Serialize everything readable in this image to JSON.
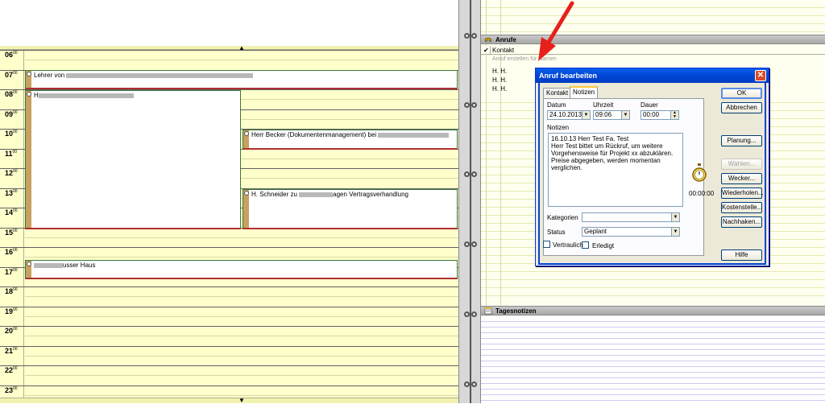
{
  "calendar": {
    "hours": [
      "06",
      "07",
      "08",
      "09",
      "10",
      "11",
      "12",
      "13",
      "14",
      "15",
      "16",
      "17",
      "18",
      "19",
      "20",
      "21",
      "22",
      "23"
    ],
    "minutes_suffix": "00",
    "appointments": [
      {
        "text": "Lehrer von",
        "redacted": true
      },
      {
        "text": "H",
        "redacted": true
      },
      {
        "text": "Herr Becker (Dokumentenmanagement) bei",
        "redacted": true
      },
      {
        "text": "H. Schneider zu",
        "text_after": "agen Vertragsverhandlung",
        "redacted": true
      },
      {
        "text": "",
        "text_after": "usser Haus",
        "redacted": true
      }
    ]
  },
  "right_panel": {
    "calls_section": {
      "title": "Anrufe",
      "check_mark": "✔",
      "column_header": "Kontakt",
      "new_call_placeholder": "Anruf erstellen für Namen",
      "rows": [
        "H. H.",
        "H. H.",
        "H. H."
      ]
    },
    "notes_section": {
      "title": "Tagesnotizen"
    }
  },
  "dialog": {
    "title": "Anruf bearbeiten",
    "close_glyph": "✕",
    "tabs": [
      "Kontakt",
      "Notizen"
    ],
    "active_tab": "Notizen",
    "date_label": "Datum",
    "date_value": "24.10.2013",
    "time_label": "Uhrzeit",
    "time_value": "09:06",
    "duration_label": "Dauer",
    "duration_value": "00:00",
    "notes_label": "Notizen",
    "notes_text": "16.10.13 Herr Test Fa. Test\nHerr Test bittet um Rückruf, um weitere Vorgehensweise für Projekt xx abzuklären.\nPreise abgegeben, werden momentan verglichen.",
    "timer_value": "00:00:00",
    "category_label": "Kategorien",
    "category_value": "",
    "status_label": "Status",
    "status_value": "Geplant",
    "done_label": "Erledigt",
    "done_checked": false,
    "confidential_label": "Vertraulich",
    "confidential_checked": false,
    "buttons": {
      "ok": "OK",
      "cancel": "Abbrechen",
      "planning": "Planung...",
      "dial": "Wählen...",
      "alarm": "Wecker...",
      "repeat": "Wiederholen...",
      "cost_center": "Kostenstelle...",
      "follow_up": "Nachhaken...",
      "help": "Hilfe"
    }
  },
  "colors": {
    "calendar_bg": "#ffffcc",
    "appointment_bar": "#c8a060",
    "dialog_title_blue": "#0046d5",
    "pointer_red": "#e8201c"
  }
}
